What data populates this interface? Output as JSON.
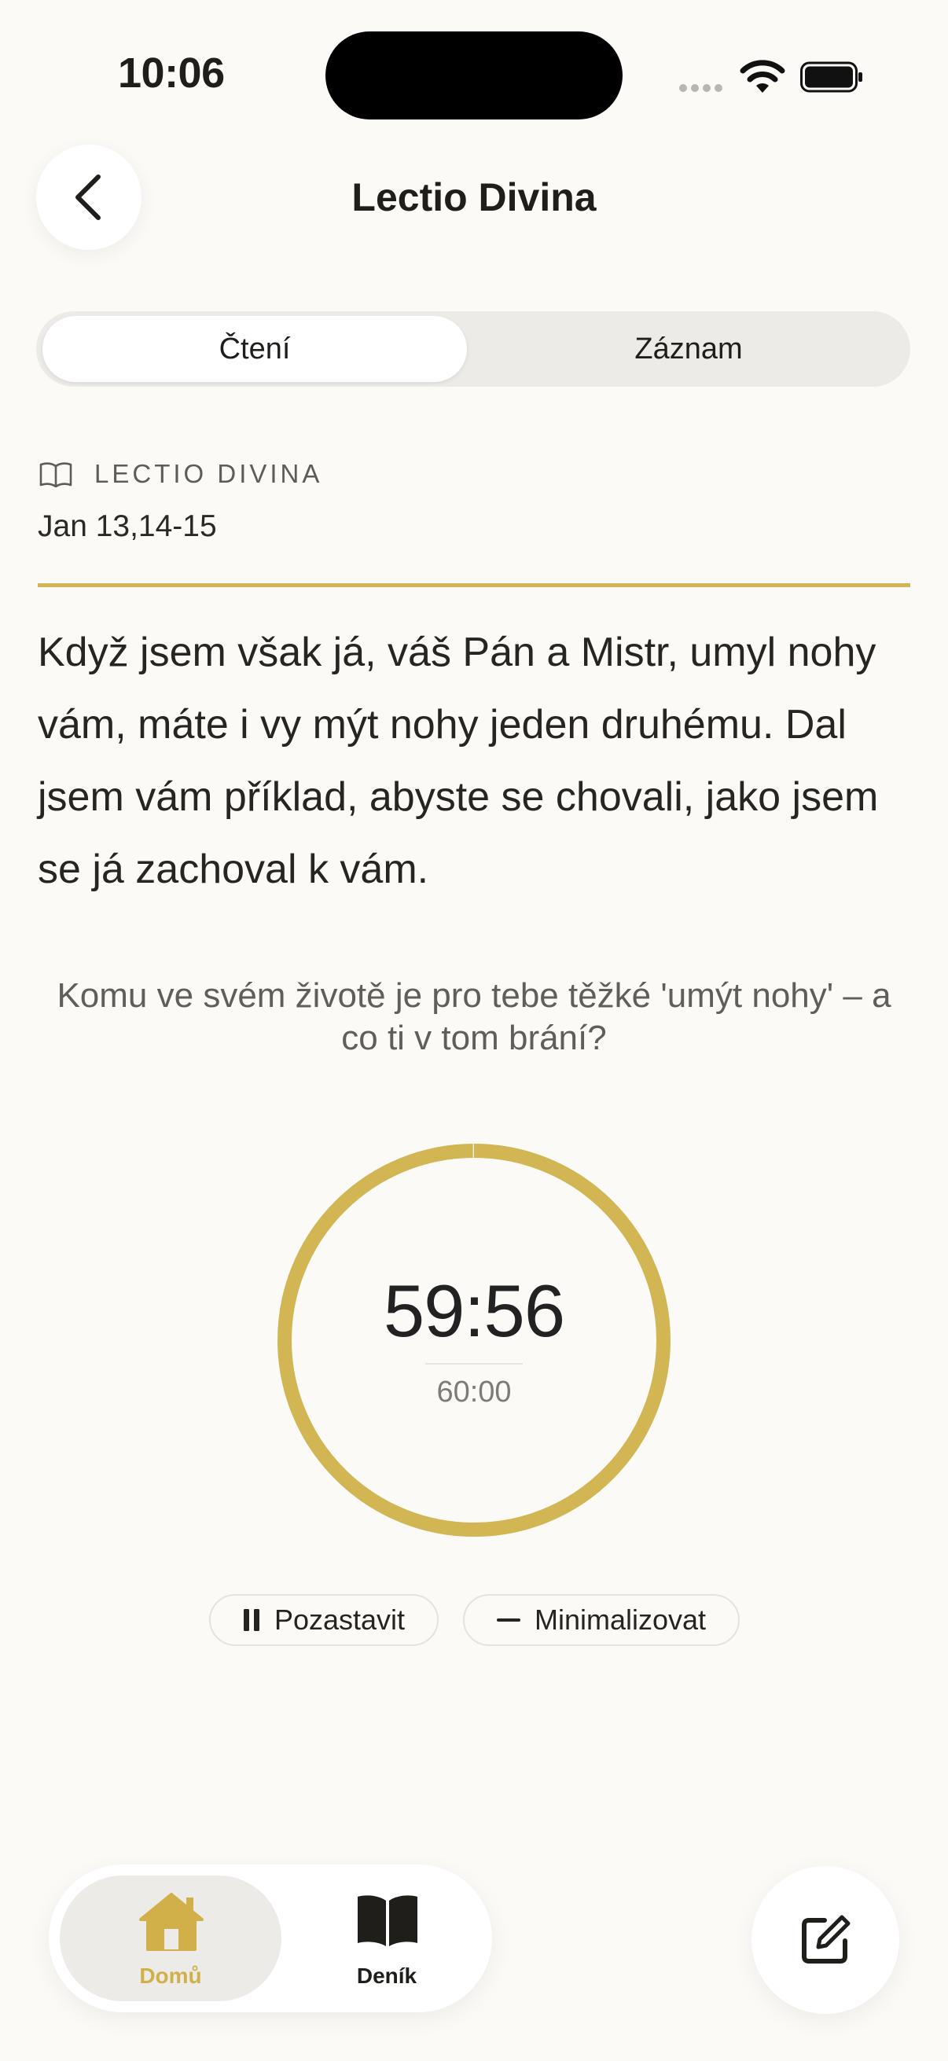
{
  "status_bar": {
    "time": "10:06"
  },
  "header": {
    "title": "Lectio Divina"
  },
  "tabs": [
    {
      "label": "Čtení",
      "selected": true
    },
    {
      "label": "Záznam",
      "selected": false
    }
  ],
  "passage": {
    "section_label": "LECTIO DIVINA",
    "reference": "Jan 13,14-15",
    "text": "Když jsem však já, váš Pán a Mistr, umyl nohy vám, máte i vy mýt nohy jeden druhému. Dal jsem vám příklad, abyste se chovali, jako jsem se já zachoval k vám."
  },
  "question": "Komu ve svém životě je pro tebe těžké 'umýt nohy' – a co ti v tom brání?",
  "timer": {
    "remaining": "59:56",
    "total": "60:00",
    "remaining_fraction": 0.9989,
    "ring_color": "#D1B653"
  },
  "controls": {
    "pause_label": "Pozastavit",
    "minimize_label": "Minimalizovat"
  },
  "nav": {
    "home_label": "Domů",
    "journal_label": "Deník",
    "active_color": "#D1B04A"
  },
  "icons": {
    "back": "chevron-left-icon",
    "book": "book-open-icon",
    "pause": "pause-icon",
    "minimize": "minus-icon",
    "home": "house-icon",
    "journal": "book-icon",
    "compose": "compose-icon"
  }
}
